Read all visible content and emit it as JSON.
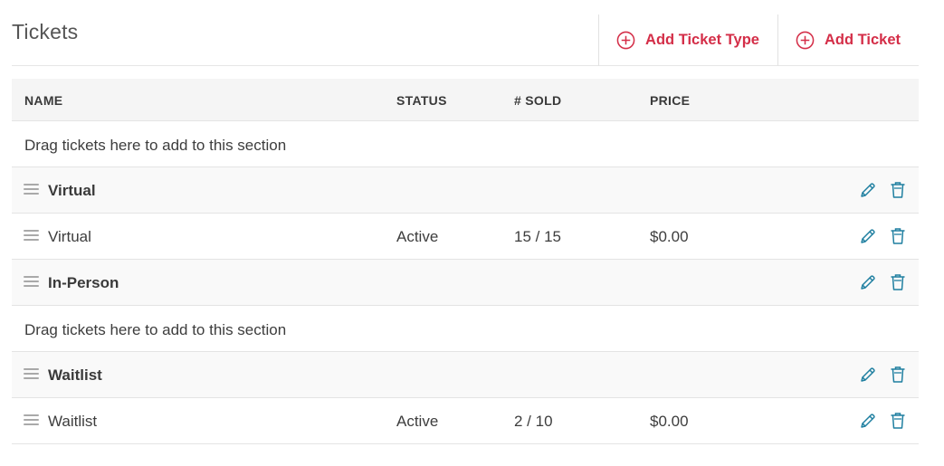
{
  "page": {
    "title": "Tickets"
  },
  "actions": {
    "add_ticket_type": "Add Ticket Type",
    "add_ticket": "Add Ticket"
  },
  "columns": {
    "name": "NAME",
    "status": "STATUS",
    "sold": "# SOLD",
    "price": "PRICE"
  },
  "drop_message": "Drag tickets here to add to this section",
  "sections": [
    {
      "name": "Virtual",
      "tickets": [
        {
          "name": "Virtual",
          "status": "Active",
          "sold": "15 / 15",
          "price": "$0.00"
        }
      ]
    },
    {
      "name": "In-Person",
      "tickets": []
    },
    {
      "name": "Waitlist",
      "tickets": [
        {
          "name": "Waitlist",
          "status": "Active",
          "sold": "2 / 10",
          "price": "$0.00"
        }
      ]
    }
  ],
  "icons": {
    "add": "plus-circle-icon",
    "drag": "drag-handle-icon",
    "edit": "pencil-icon",
    "delete": "trash-icon"
  },
  "colors": {
    "accent": "#d42e48",
    "icon": "#1f7fa0"
  }
}
